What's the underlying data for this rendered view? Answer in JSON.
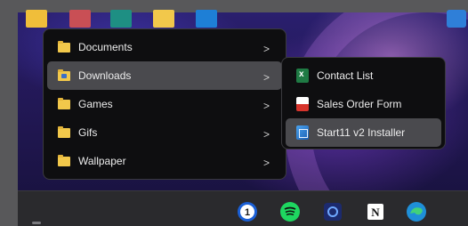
{
  "main_menu": {
    "items": [
      {
        "label": "Documents",
        "icon": "folder-icon"
      },
      {
        "label": "Downloads",
        "icon": "downloads-folder-icon"
      },
      {
        "label": "Games",
        "icon": "folder-icon"
      },
      {
        "label": "Gifs",
        "icon": "folder-icon"
      },
      {
        "label": "Wallpaper",
        "icon": "folder-icon"
      }
    ],
    "chevron": ">"
  },
  "sub_menu": {
    "items": [
      {
        "label": "Contact List",
        "icon": "excel-file-icon"
      },
      {
        "label": "Sales Order Form",
        "icon": "pdf-file-icon"
      },
      {
        "label": "Start11 v2 Installer",
        "icon": "installer-icon"
      }
    ]
  },
  "taskbar": {
    "icons": [
      "file-explorer-icon",
      "folder-shortcut-icon",
      "app-icon-teal",
      "folder-icon",
      "folder-blue-icon",
      "1password-icon",
      "spotify-icon",
      "camera-app-icon",
      "notion-icon",
      "edge-icon",
      "store-icon"
    ],
    "notion_glyph": "N",
    "onepassword_glyph": "1"
  },
  "colors": {
    "menu_bg": "#0e0e10",
    "menu_active": "#4a4a4e",
    "folder": "#f2c84b",
    "taskbar_bg": "#2a2a2d"
  }
}
